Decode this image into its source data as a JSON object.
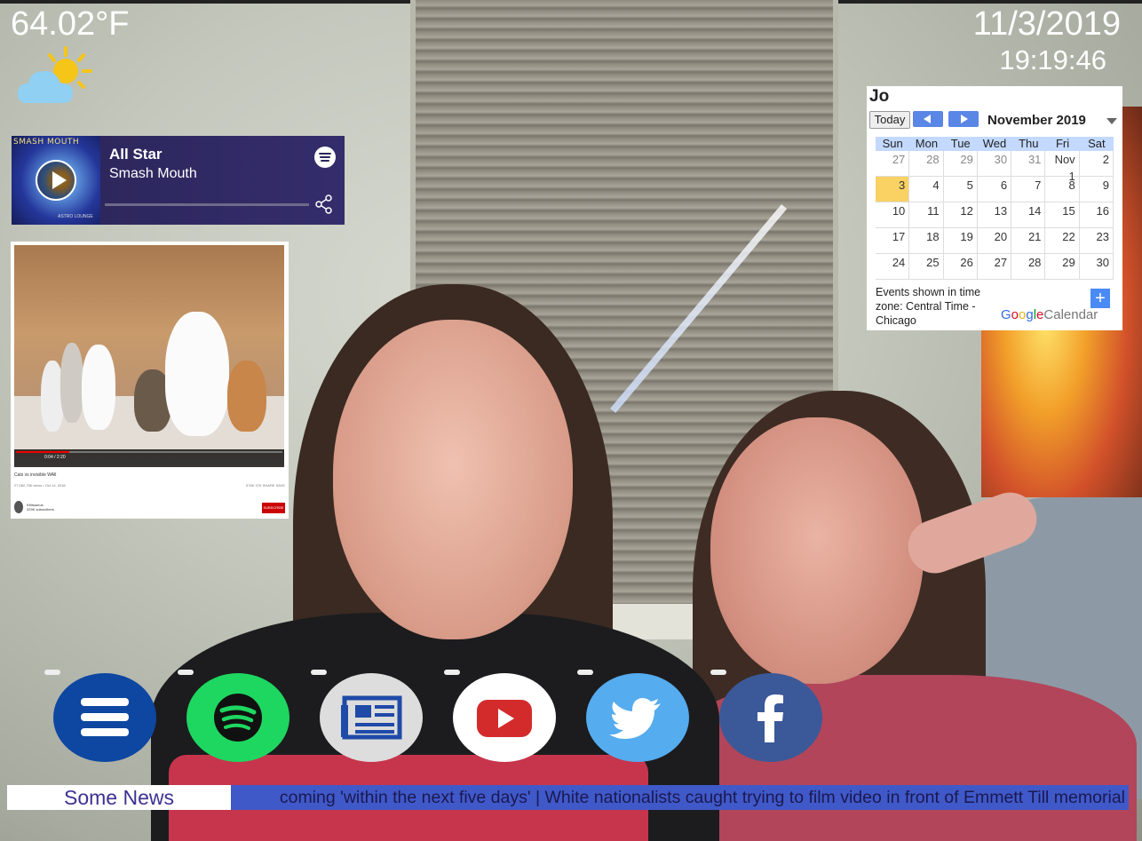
{
  "weather": {
    "temperature": "64.02°F",
    "icon": "partly-cloudy-icon"
  },
  "clock": {
    "date": "11/3/2019",
    "time": "19:19:46"
  },
  "spotify": {
    "track": "All Star",
    "artist": "Smash Mouth",
    "album_art_text": "SMASH MOUTH",
    "album_art_sub": "ASTRO LOUNGE",
    "icons": [
      "play-icon",
      "spotify-logo-icon",
      "share-icon"
    ],
    "progress": 0
  },
  "youtube": {
    "video_title": "Cats vs invisible WAll",
    "views": "27,082,756 views • Oct 14, 2018",
    "stats": "978K  37K  SHARE  SAVE",
    "time": "0:04 / 2:20",
    "channel": "Kittisaurus",
    "channel_subs": "329K subscribers",
    "subscribe": "SUBSCRIBE",
    "progress": 0.2
  },
  "calendar": {
    "owner": "Jo",
    "today_label": "Today",
    "month": "November 2019",
    "weekdays": [
      "Sun",
      "Mon",
      "Tue",
      "Wed",
      "Thu",
      "Fri",
      "Sat"
    ],
    "weeks": [
      [
        "27",
        "28",
        "29",
        "30",
        "31",
        "Nov 1",
        "2"
      ],
      [
        "3",
        "4",
        "5",
        "6",
        "7",
        "8",
        "9"
      ],
      [
        "10",
        "11",
        "12",
        "13",
        "14",
        "15",
        "16"
      ],
      [
        "17",
        "18",
        "19",
        "20",
        "21",
        "22",
        "23"
      ],
      [
        "24",
        "25",
        "26",
        "27",
        "28",
        "29",
        "30"
      ]
    ],
    "timezone_note": "Events shown in time zone: Central Time - Chicago",
    "add_label": "+",
    "brand_google": "Google",
    "brand_calendar": "Calendar",
    "today_color": "#fad163",
    "header_color": "#c3d9ff"
  },
  "dock": {
    "apps": [
      {
        "name": "menu",
        "icon": "menu-icon",
        "color": "#0d47a1"
      },
      {
        "name": "spotify",
        "icon": "spotify-icon",
        "color": "#1ed760"
      },
      {
        "name": "news",
        "icon": "newspaper-icon",
        "color": "#dddddd"
      },
      {
        "name": "youtube",
        "icon": "youtube-icon",
        "color": "#ffffff"
      },
      {
        "name": "twitter",
        "icon": "twitter-icon",
        "color": "#55acee"
      },
      {
        "name": "facebook",
        "icon": "facebook-icon",
        "color": "#3b5998"
      }
    ]
  },
  "news": {
    "label": "Some News",
    "ticker": "coming 'within the next five days'    |    White nationalists caught trying to film video in front of Emmett Till memorial"
  }
}
